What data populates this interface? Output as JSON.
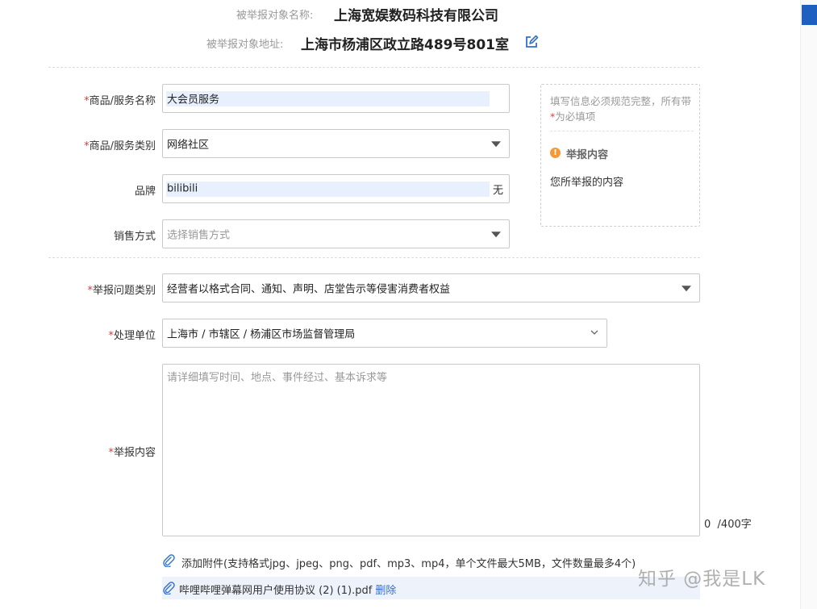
{
  "target": {
    "name_label": "被举报对象名称:",
    "name_value": "上海宽娱数码科技有限公司",
    "address_label": "被举报对象地址:",
    "address_value": "上海市杨浦区政立路489号801室"
  },
  "form": {
    "required_mark": "*",
    "product_name": {
      "label": "商品/服务名称",
      "value": "大会员服务"
    },
    "product_category": {
      "label": "商品/服务类别",
      "value": "网络社区"
    },
    "brand": {
      "label": "品牌",
      "value": "bilibili",
      "none_option": "无"
    },
    "sales_method": {
      "label": "销售方式",
      "placeholder": "选择销售方式"
    },
    "issue_category": {
      "label": "举报问题类别",
      "value": "经营者以格式合同、通知、声明、店堂告示等侵害消费者权益"
    },
    "handling_unit": {
      "label": "处理单位",
      "value": "上海市 / 市辖区 / 杨浦区市场监督管理局"
    },
    "report_content": {
      "label": "举报内容",
      "placeholder": "请详细填写时间、地点、事件经过、基本诉求等",
      "count": "0",
      "limit": "/400字"
    }
  },
  "side_panel": {
    "hint_prefix": "填写信息必须规范完整，所有带",
    "hint_star": "*",
    "hint_suffix": "为必填项",
    "title": "举报内容",
    "description": "您所举报的内容"
  },
  "attachment": {
    "add_text": "添加附件(支持格式jpg、jpeg、png、pdf、mp3、mp4，单个文件最大5MB，文件数量最多4个)",
    "file_name": "哔哩哔哩弹幕网用户使用协议 (2) (1).pdf",
    "delete_label": "删除"
  },
  "watermark": "知乎 @我是LK",
  "icons": {
    "edit": "edit-icon",
    "dropdown": "caret-down-icon",
    "cascader": "chevron-down-icon",
    "warning": "warning-icon",
    "attachment": "paperclip-icon"
  },
  "colors": {
    "accent": "#1f5fbf",
    "required": "#e23b3b",
    "warning": "#f29a38",
    "link": "#2f6fd6"
  }
}
